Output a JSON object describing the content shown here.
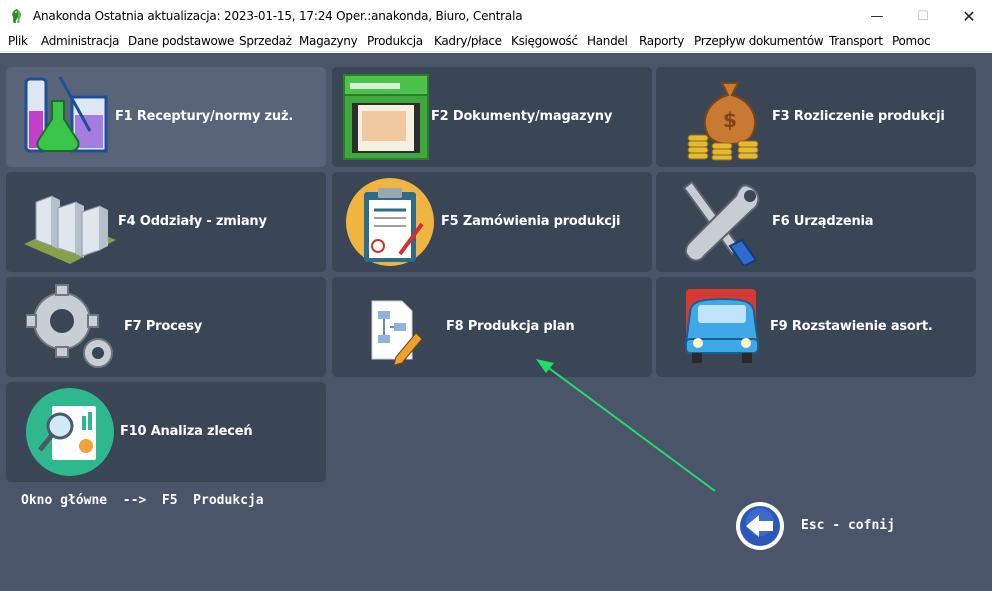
{
  "window": {
    "title": "Anakonda Ostatnia aktualizacja: 2023-01-15, 17:24 Oper.:anakonda, Biuro, Centrala",
    "minimize_glyph": "—",
    "maximize_glyph": "☐",
    "close_glyph": "✕"
  },
  "menu": [
    "Plik",
    "Administracja",
    "Dane podstawowe",
    "Sprzedaż",
    "Magazyny",
    "Produkcja",
    "Kadry/płace",
    "Księgowość",
    "Handel",
    "Raporty",
    "Przepływ dokumentów",
    "Transport",
    "Pomoc"
  ],
  "tiles": [
    {
      "label": "F1  Receptury/normy zuż.",
      "icon": "lab-flask-icon"
    },
    {
      "label": "F2  Dokumenty/magazyny",
      "icon": "file-drawer-icon"
    },
    {
      "label": "F3  Rozliczenie produkcji",
      "icon": "money-bag-icon"
    },
    {
      "label": "F4  Oddziały - zmiany",
      "icon": "buildings-icon"
    },
    {
      "label": "F5  Zamówienia produkcji",
      "icon": "clipboard-icon"
    },
    {
      "label": "F6  Urządzenia",
      "icon": "tools-icon"
    },
    {
      "label": "F7  Procesy",
      "icon": "gears-icon"
    },
    {
      "label": "F8  Produkcja plan",
      "icon": "flowchart-document-icon"
    },
    {
      "label": "F9  Rozstawienie asort.",
      "icon": "truck-icon"
    },
    {
      "label": "F10  Analiza zleceń",
      "icon": "analytics-icon"
    }
  ],
  "breadcrumb": "Okno główne  -->  F5  Produkcja",
  "esc_button": {
    "label": "Esc - cofnij",
    "icon": "back-arrow-icon"
  },
  "colors": {
    "background": "#4a5569",
    "tile": "#3a4556",
    "tile_highlight": "#596478",
    "annotation_arrow": "#22dd66"
  }
}
